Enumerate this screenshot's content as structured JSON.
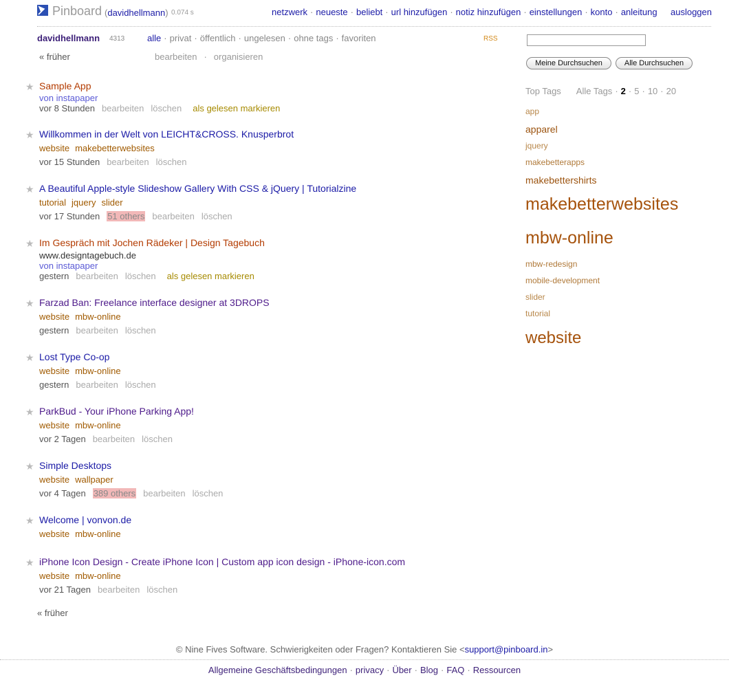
{
  "header": {
    "brand": "Pinboard",
    "user": "davidhellmann",
    "timing": "0.074 s",
    "nav": [
      "netzwerk",
      "neueste",
      "beliebt",
      "url hinzufügen",
      "notiz hinzufügen",
      "einstellungen",
      "konto",
      "anleitung"
    ],
    "logout": "ausloggen"
  },
  "filterbar": {
    "username": "davidhellmann",
    "count": "4313",
    "filters": [
      "alle",
      "privat",
      "öffentlich",
      "ungelesen",
      "ohne tags",
      "favoriten"
    ],
    "rss": "RSS",
    "earlier": "« früher",
    "edit": "bearbeiten",
    "organize": "organisieren"
  },
  "actions": {
    "edit": "bearbeiten",
    "delete": "löschen",
    "mark_read": "als gelesen markieren"
  },
  "bookmarks": [
    {
      "title": "Sample App",
      "via": "von instapaper",
      "time": "vor 8 Stunden"
    },
    {
      "title": "Willkommen in der Welt von LEICHT&CROSS. Knusperbrot",
      "tags": [
        "website",
        "makebetterwebsites"
      ],
      "time": "vor 15 Stunden"
    },
    {
      "title": "A Beautiful Apple-style Slideshow Gallery With CSS & jQuery | Tutorialzine",
      "tags": [
        "tutorial",
        "jquery",
        "slider"
      ],
      "time": "vor 17 Stunden",
      "others": "51 others"
    },
    {
      "title": "Im Gespräch mit Jochen Rädeker | Design Tagebuch",
      "url": "www.designtagebuch.de",
      "via": "von instapaper",
      "time": "gestern"
    },
    {
      "title": "Farzad Ban: Freelance interface designer at 3DROPS",
      "tags": [
        "website",
        "mbw-online"
      ],
      "time": "gestern"
    },
    {
      "title": "Lost Type Co-op",
      "tags": [
        "website",
        "mbw-online"
      ],
      "time": "gestern"
    },
    {
      "title": "ParkBud - Your iPhone Parking App!",
      "tags": [
        "website",
        "mbw-online"
      ],
      "time": "vor 2 Tagen"
    },
    {
      "title": "Simple Desktops",
      "tags": [
        "website",
        "wallpaper"
      ],
      "time": "vor 4 Tagen",
      "others": "389 others"
    },
    {
      "title": "Welcome | vonvon.de",
      "tags": [
        "website",
        "mbw-online"
      ]
    },
    {
      "title": "iPhone Icon Design - Create iPhone Icon | Custom app icon design - iPhone-icon.com",
      "tags": [
        "website",
        "mbw-online"
      ],
      "time": "vor 21 Tagen"
    }
  ],
  "earlier_bottom": "« früher",
  "sidebar": {
    "search_mine": "Meine Durchsuchen",
    "search_all": "Alle Durchsuchen",
    "top_tags": "Top Tags",
    "all_tags": "Alle Tags",
    "counts": [
      "2",
      "5",
      "10",
      "20"
    ],
    "tags": [
      "app",
      "apparel",
      "jquery",
      "makebetterapps",
      "makebettershirts",
      "makebetterwebsites",
      "mbw-online",
      "mbw-redesign",
      "mobile-development",
      "slider",
      "tutorial",
      "website"
    ]
  },
  "footer": {
    "text": "© Nine Fives Software. Schwierigkeiten oder Fragen? Kontaktieren Sie <",
    "email": "support@pinboard.in",
    "close": ">",
    "links": [
      "Allgemeine Geschäftsbedingungen",
      "privacy",
      "Über",
      "Blog",
      "FAQ",
      "Ressourcen"
    ]
  },
  "colors": {
    "link": "#1a1aa6",
    "unread": "#b33b00",
    "tag": "#a05a00",
    "others_highlight": "#f2b8b8"
  }
}
